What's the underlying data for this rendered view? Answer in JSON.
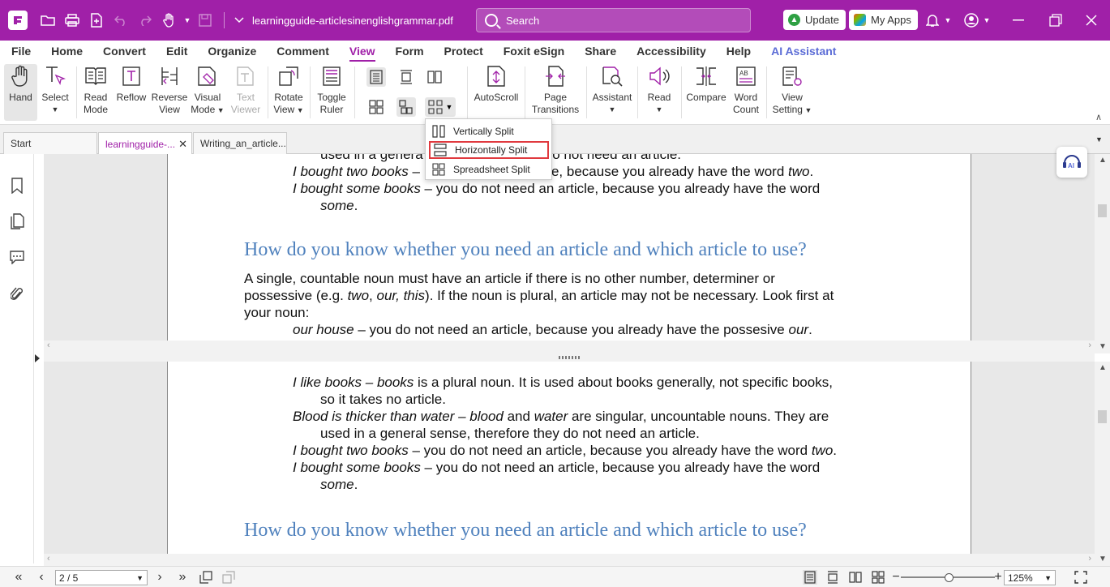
{
  "titlebar": {
    "doc_title": "learningguide-articlesinenglishgrammar.pdf",
    "search_placeholder": "Search",
    "update_label": "Update",
    "myapps_label": "My Apps"
  },
  "menu": [
    "File",
    "Home",
    "Convert",
    "Edit",
    "Organize",
    "Comment",
    "View",
    "Form",
    "Protect",
    "Foxit eSign",
    "Share",
    "Accessibility",
    "Help",
    "AI Assistant"
  ],
  "ribbon": {
    "hand": "Hand",
    "select": "Select",
    "read_mode_1": "Read",
    "read_mode_2": "Mode",
    "reflow": "Reflow",
    "reverse_1": "Reverse",
    "reverse_2": "View",
    "visual_1": "Visual",
    "visual_2": "Mode",
    "text_1": "Text",
    "text_2": "Viewer",
    "rotate_1": "Rotate",
    "rotate_2": "View",
    "toggle_1": "Toggle",
    "toggle_2": "Ruler",
    "autoscroll": "AutoScroll",
    "page_1": "Page",
    "page_2": "Transitions",
    "assistant": "Assistant",
    "read": "Read",
    "compare": "Compare",
    "word_1": "Word",
    "word_2": "Count",
    "viewset_1": "View",
    "viewset_2": "Setting"
  },
  "tabs": {
    "start": "Start",
    "doc1": "learningguide-...",
    "doc2": "Writing_an_article..."
  },
  "split_menu": {
    "vertical": "Vertically Split",
    "horizontal": "Horizontally Split",
    "spreadsheet": "Spreadsheet Split"
  },
  "doc_top": {
    "l1a": "used in a genera",
    "l1b": "hey do not need an article.",
    "l2a": "I bought two books",
    "l2b": " –",
    "l2c": "n article, because you already have the word ",
    "l2d": "two",
    "l2e": ".",
    "l3a": "I bought some books",
    "l3b": " – you do not need an article, because you already have the word",
    "l4a": "some",
    "l4b": ".",
    "heading": "How do you know whether you need an article and which article to use?",
    "p1": "A single, countable noun must have an article if there is no other number, determiner or",
    "p2a": "possessive (e.g. ",
    "p2b": "two",
    "p2c": ", ",
    "p2d": "our, this",
    "p2e": "). If the noun is plural, an article may not be necessary. Look first at",
    "p3": "your noun:",
    "p4a": "our house",
    "p4b": " – you do not need an article, because you already have the possesive ",
    "p4c": "our",
    "p4d": "."
  },
  "doc_bottom": {
    "b1a": "I like books – books",
    "b1b": " is a plural noun. It is used about books generally, not specific books,",
    "b2": "so it takes no article.",
    "b3a": "Blood is thicker than water – blood",
    "b3b": " and ",
    "b3c": "water",
    "b3d": " are singular, uncountable nouns. They are",
    "b4": "used in a general sense, therefore they do not need an article.",
    "b5a": "I bought two books",
    "b5b": " – you do not need an article, because you already have the word ",
    "b5c": "two",
    "b5d": ".",
    "b6a": "I bought some books",
    "b6b": " – you do not need an article, because you already have the word",
    "b7a": "some",
    "b7b": ".",
    "heading": "How do you know whether you need an article and which article to use?"
  },
  "status": {
    "page": "2 / 5",
    "zoom": "125%"
  },
  "colors": {
    "brand": "#a020a8",
    "heading": "#4f81bd",
    "highlight": "#e0393e"
  }
}
